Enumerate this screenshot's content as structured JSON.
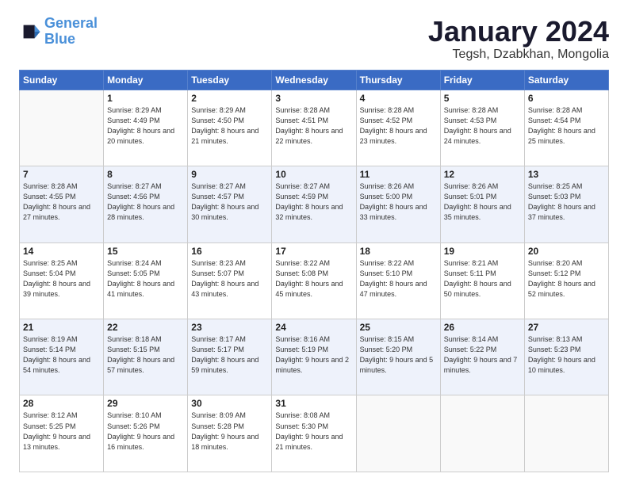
{
  "logo": {
    "line1": "General",
    "line2": "Blue"
  },
  "title": "January 2024",
  "subtitle": "Tegsh, Dzabkhan, Mongolia",
  "weekdays": [
    "Sunday",
    "Monday",
    "Tuesday",
    "Wednesday",
    "Thursday",
    "Friday",
    "Saturday"
  ],
  "weeks": [
    [
      {
        "day": "",
        "sunrise": "",
        "sunset": "",
        "daylight": ""
      },
      {
        "day": "1",
        "sunrise": "Sunrise: 8:29 AM",
        "sunset": "Sunset: 4:49 PM",
        "daylight": "Daylight: 8 hours and 20 minutes."
      },
      {
        "day": "2",
        "sunrise": "Sunrise: 8:29 AM",
        "sunset": "Sunset: 4:50 PM",
        "daylight": "Daylight: 8 hours and 21 minutes."
      },
      {
        "day": "3",
        "sunrise": "Sunrise: 8:28 AM",
        "sunset": "Sunset: 4:51 PM",
        "daylight": "Daylight: 8 hours and 22 minutes."
      },
      {
        "day": "4",
        "sunrise": "Sunrise: 8:28 AM",
        "sunset": "Sunset: 4:52 PM",
        "daylight": "Daylight: 8 hours and 23 minutes."
      },
      {
        "day": "5",
        "sunrise": "Sunrise: 8:28 AM",
        "sunset": "Sunset: 4:53 PM",
        "daylight": "Daylight: 8 hours and 24 minutes."
      },
      {
        "day": "6",
        "sunrise": "Sunrise: 8:28 AM",
        "sunset": "Sunset: 4:54 PM",
        "daylight": "Daylight: 8 hours and 25 minutes."
      }
    ],
    [
      {
        "day": "7",
        "sunrise": "Sunrise: 8:28 AM",
        "sunset": "Sunset: 4:55 PM",
        "daylight": "Daylight: 8 hours and 27 minutes."
      },
      {
        "day": "8",
        "sunrise": "Sunrise: 8:27 AM",
        "sunset": "Sunset: 4:56 PM",
        "daylight": "Daylight: 8 hours and 28 minutes."
      },
      {
        "day": "9",
        "sunrise": "Sunrise: 8:27 AM",
        "sunset": "Sunset: 4:57 PM",
        "daylight": "Daylight: 8 hours and 30 minutes."
      },
      {
        "day": "10",
        "sunrise": "Sunrise: 8:27 AM",
        "sunset": "Sunset: 4:59 PM",
        "daylight": "Daylight: 8 hours and 32 minutes."
      },
      {
        "day": "11",
        "sunrise": "Sunrise: 8:26 AM",
        "sunset": "Sunset: 5:00 PM",
        "daylight": "Daylight: 8 hours and 33 minutes."
      },
      {
        "day": "12",
        "sunrise": "Sunrise: 8:26 AM",
        "sunset": "Sunset: 5:01 PM",
        "daylight": "Daylight: 8 hours and 35 minutes."
      },
      {
        "day": "13",
        "sunrise": "Sunrise: 8:25 AM",
        "sunset": "Sunset: 5:03 PM",
        "daylight": "Daylight: 8 hours and 37 minutes."
      }
    ],
    [
      {
        "day": "14",
        "sunrise": "Sunrise: 8:25 AM",
        "sunset": "Sunset: 5:04 PM",
        "daylight": "Daylight: 8 hours and 39 minutes."
      },
      {
        "day": "15",
        "sunrise": "Sunrise: 8:24 AM",
        "sunset": "Sunset: 5:05 PM",
        "daylight": "Daylight: 8 hours and 41 minutes."
      },
      {
        "day": "16",
        "sunrise": "Sunrise: 8:23 AM",
        "sunset": "Sunset: 5:07 PM",
        "daylight": "Daylight: 8 hours and 43 minutes."
      },
      {
        "day": "17",
        "sunrise": "Sunrise: 8:22 AM",
        "sunset": "Sunset: 5:08 PM",
        "daylight": "Daylight: 8 hours and 45 minutes."
      },
      {
        "day": "18",
        "sunrise": "Sunrise: 8:22 AM",
        "sunset": "Sunset: 5:10 PM",
        "daylight": "Daylight: 8 hours and 47 minutes."
      },
      {
        "day": "19",
        "sunrise": "Sunrise: 8:21 AM",
        "sunset": "Sunset: 5:11 PM",
        "daylight": "Daylight: 8 hours and 50 minutes."
      },
      {
        "day": "20",
        "sunrise": "Sunrise: 8:20 AM",
        "sunset": "Sunset: 5:12 PM",
        "daylight": "Daylight: 8 hours and 52 minutes."
      }
    ],
    [
      {
        "day": "21",
        "sunrise": "Sunrise: 8:19 AM",
        "sunset": "Sunset: 5:14 PM",
        "daylight": "Daylight: 8 hours and 54 minutes."
      },
      {
        "day": "22",
        "sunrise": "Sunrise: 8:18 AM",
        "sunset": "Sunset: 5:15 PM",
        "daylight": "Daylight: 8 hours and 57 minutes."
      },
      {
        "day": "23",
        "sunrise": "Sunrise: 8:17 AM",
        "sunset": "Sunset: 5:17 PM",
        "daylight": "Daylight: 8 hours and 59 minutes."
      },
      {
        "day": "24",
        "sunrise": "Sunrise: 8:16 AM",
        "sunset": "Sunset: 5:19 PM",
        "daylight": "Daylight: 9 hours and 2 minutes."
      },
      {
        "day": "25",
        "sunrise": "Sunrise: 8:15 AM",
        "sunset": "Sunset: 5:20 PM",
        "daylight": "Daylight: 9 hours and 5 minutes."
      },
      {
        "day": "26",
        "sunrise": "Sunrise: 8:14 AM",
        "sunset": "Sunset: 5:22 PM",
        "daylight": "Daylight: 9 hours and 7 minutes."
      },
      {
        "day": "27",
        "sunrise": "Sunrise: 8:13 AM",
        "sunset": "Sunset: 5:23 PM",
        "daylight": "Daylight: 9 hours and 10 minutes."
      }
    ],
    [
      {
        "day": "28",
        "sunrise": "Sunrise: 8:12 AM",
        "sunset": "Sunset: 5:25 PM",
        "daylight": "Daylight: 9 hours and 13 minutes."
      },
      {
        "day": "29",
        "sunrise": "Sunrise: 8:10 AM",
        "sunset": "Sunset: 5:26 PM",
        "daylight": "Daylight: 9 hours and 16 minutes."
      },
      {
        "day": "30",
        "sunrise": "Sunrise: 8:09 AM",
        "sunset": "Sunset: 5:28 PM",
        "daylight": "Daylight: 9 hours and 18 minutes."
      },
      {
        "day": "31",
        "sunrise": "Sunrise: 8:08 AM",
        "sunset": "Sunset: 5:30 PM",
        "daylight": "Daylight: 9 hours and 21 minutes."
      },
      {
        "day": "",
        "sunrise": "",
        "sunset": "",
        "daylight": ""
      },
      {
        "day": "",
        "sunrise": "",
        "sunset": "",
        "daylight": ""
      },
      {
        "day": "",
        "sunrise": "",
        "sunset": "",
        "daylight": ""
      }
    ]
  ]
}
